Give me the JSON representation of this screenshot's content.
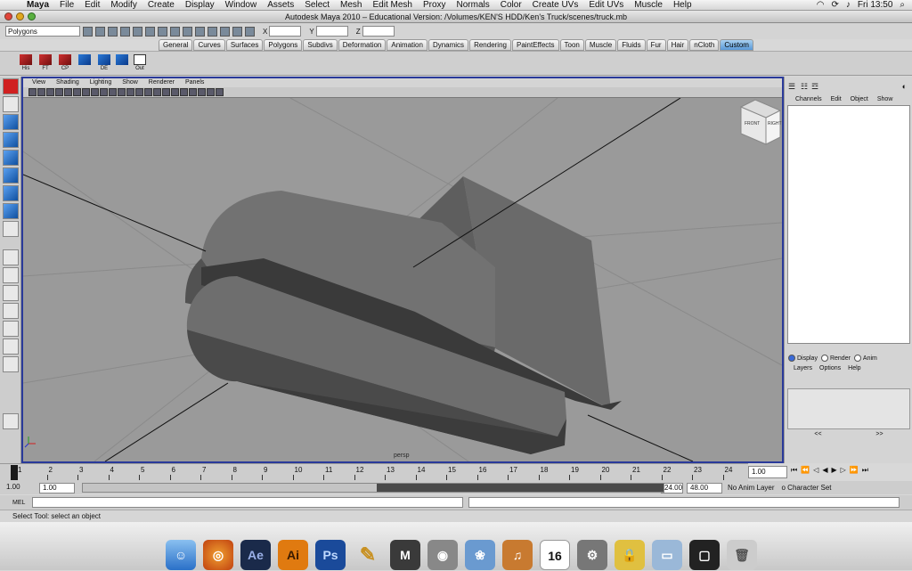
{
  "menubar": {
    "app": "Maya",
    "items": [
      "File",
      "Edit",
      "Modify",
      "Create",
      "Display",
      "Window",
      "Assets",
      "Select",
      "Mesh",
      "Edit Mesh",
      "Proxy",
      "Normals",
      "Color",
      "Create UVs",
      "Edit UVs",
      "Muscle",
      "Help"
    ],
    "clock": "Fri 13:50"
  },
  "window": {
    "title": "Autodesk Maya 2010 – Educational Version: /Volumes/KEN'S HDD/Ken's Truck/scenes/truck.mb"
  },
  "statusline": {
    "mode": "Polygons",
    "x_label": "X",
    "y_label": "Y",
    "z_label": "Z"
  },
  "shelf": {
    "tabs": [
      "General",
      "Curves",
      "Surfaces",
      "Polygons",
      "Subdivs",
      "Deformation",
      "Animation",
      "Dynamics",
      "Rendering",
      "PaintEffects",
      "Toon",
      "Muscle",
      "Fluids",
      "Fur",
      "Hair",
      "nCloth",
      "Custom"
    ],
    "active_tab": "Custom",
    "buttons": [
      "His",
      "FT",
      "CP",
      "",
      "DE",
      "",
      "Out"
    ]
  },
  "viewport": {
    "menu": [
      "View",
      "Shading",
      "Lighting",
      "Show",
      "Renderer",
      "Panels"
    ],
    "camera": "persp",
    "viewcube": [
      "FRONT",
      "RIGHT"
    ]
  },
  "channelbox": {
    "menu": [
      "Channels",
      "Edit",
      "Object",
      "Show"
    ],
    "layer_modes": [
      "Display",
      "Render",
      "Anim"
    ],
    "active_layer_mode": "Display",
    "layer_menu": [
      "Layers",
      "Options",
      "Help"
    ],
    "nav_prev": "<<",
    "nav_next": ">>"
  },
  "timeline": {
    "ticks": [
      1,
      2,
      3,
      4,
      5,
      6,
      7,
      8,
      9,
      10,
      11,
      12,
      13,
      14,
      15,
      16,
      17,
      18,
      19,
      20,
      21,
      22,
      23,
      24
    ],
    "current_frame": "1.00"
  },
  "range": {
    "start": "1.00",
    "playback_start": "1.00",
    "playback_end": "24.00",
    "end": "48.00",
    "anim_layer": "No Anim Layer",
    "char_set": "o Character Set"
  },
  "cmdline": {
    "label": "MEL"
  },
  "helpline": {
    "text": "Select Tool: select an object"
  },
  "dock": {
    "apps": [
      "Finder",
      "Firefox",
      "Ae",
      "Ai",
      "Ps",
      "Pencil",
      "Maya",
      "Photo Booth",
      "iPhoto",
      "GarageBand",
      "iCal",
      "System Preferences",
      "Keychain",
      "Folder",
      "Screen",
      "Trash"
    ],
    "calendar_day": "16",
    "colors": {
      "ae": "#1a2a4a",
      "ai": "#e07a10",
      "ps": "#1a4a9a",
      "firefox": "#d86020"
    }
  }
}
